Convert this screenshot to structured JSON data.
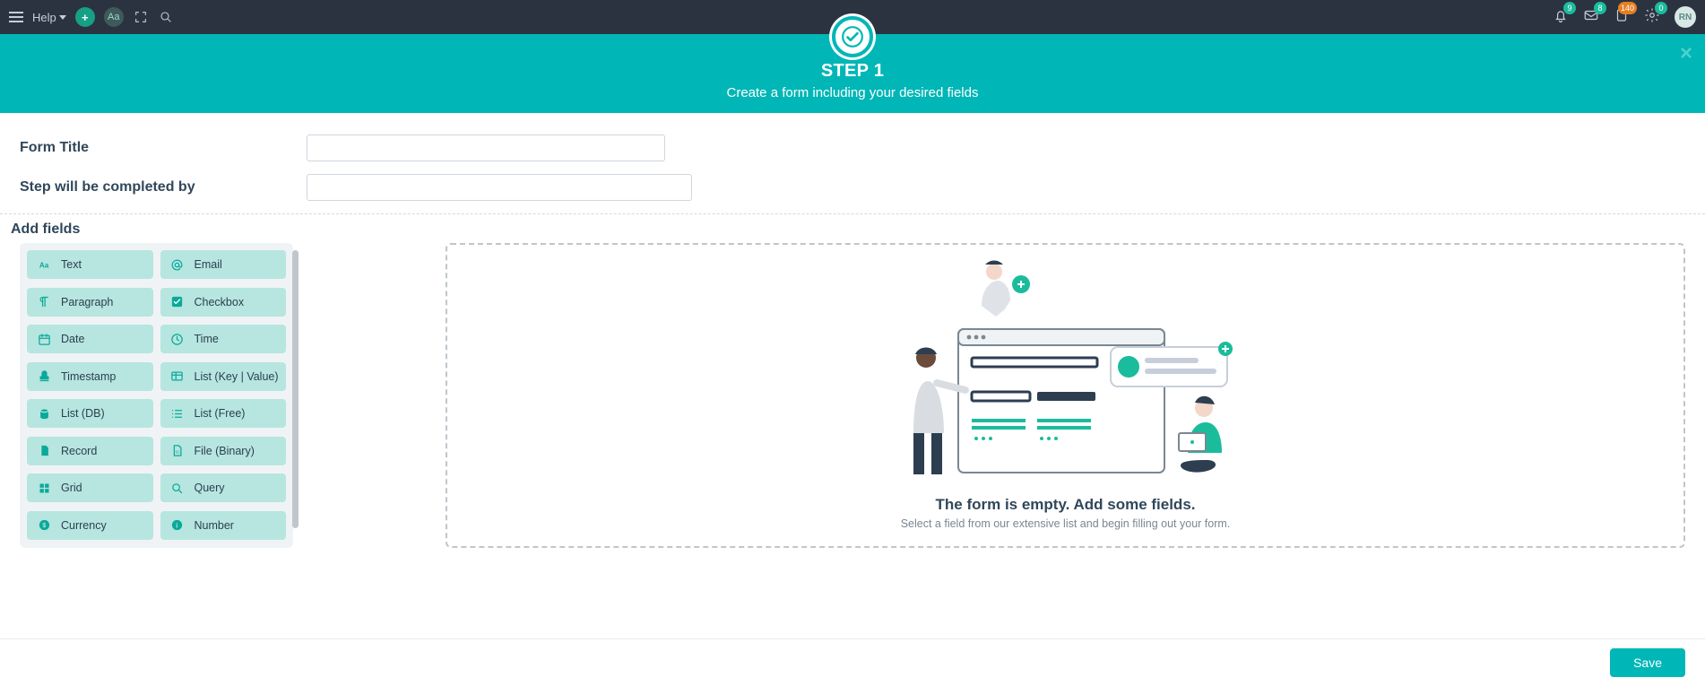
{
  "appbar": {
    "help_label": "Help",
    "badges": {
      "bell": "9",
      "mail": "8",
      "clipboard": "140",
      "gear": "0"
    },
    "avatar_initials": "RN"
  },
  "banner": {
    "step_label": "STEP 1",
    "subtitle": "Create a form including your desired fields"
  },
  "form": {
    "title_label": "Form Title",
    "completed_by_label": "Step will be completed by",
    "title_value": "",
    "completed_by_value": ""
  },
  "section": {
    "add_fields_label": "Add fields"
  },
  "palette": [
    {
      "id": "text",
      "label": "Text",
      "icon": "aa"
    },
    {
      "id": "email",
      "label": "Email",
      "icon": "at"
    },
    {
      "id": "paragraph",
      "label": "Paragraph",
      "icon": "para"
    },
    {
      "id": "checkbox",
      "label": "Checkbox",
      "icon": "check"
    },
    {
      "id": "date",
      "label": "Date",
      "icon": "cal"
    },
    {
      "id": "time",
      "label": "Time",
      "icon": "clock"
    },
    {
      "id": "timestamp",
      "label": "Timestamp",
      "icon": "stamp"
    },
    {
      "id": "list-kv",
      "label": "List (Key | Value)",
      "icon": "listkv"
    },
    {
      "id": "list-db",
      "label": "List (DB)",
      "icon": "db"
    },
    {
      "id": "list-free",
      "label": "List (Free)",
      "icon": "listfree"
    },
    {
      "id": "record",
      "label": "Record",
      "icon": "file"
    },
    {
      "id": "file-binary",
      "label": "File (Binary)",
      "icon": "filebin"
    },
    {
      "id": "grid",
      "label": "Grid",
      "icon": "grid"
    },
    {
      "id": "query",
      "label": "Query",
      "icon": "search"
    },
    {
      "id": "currency",
      "label": "Currency",
      "icon": "money"
    },
    {
      "id": "number",
      "label": "Number",
      "icon": "info"
    }
  ],
  "canvas": {
    "empty_title": "The form is empty. Add some fields.",
    "empty_desc": "Select a field from our extensive list and begin filling out your form."
  },
  "footer": {
    "save_label": "Save"
  }
}
